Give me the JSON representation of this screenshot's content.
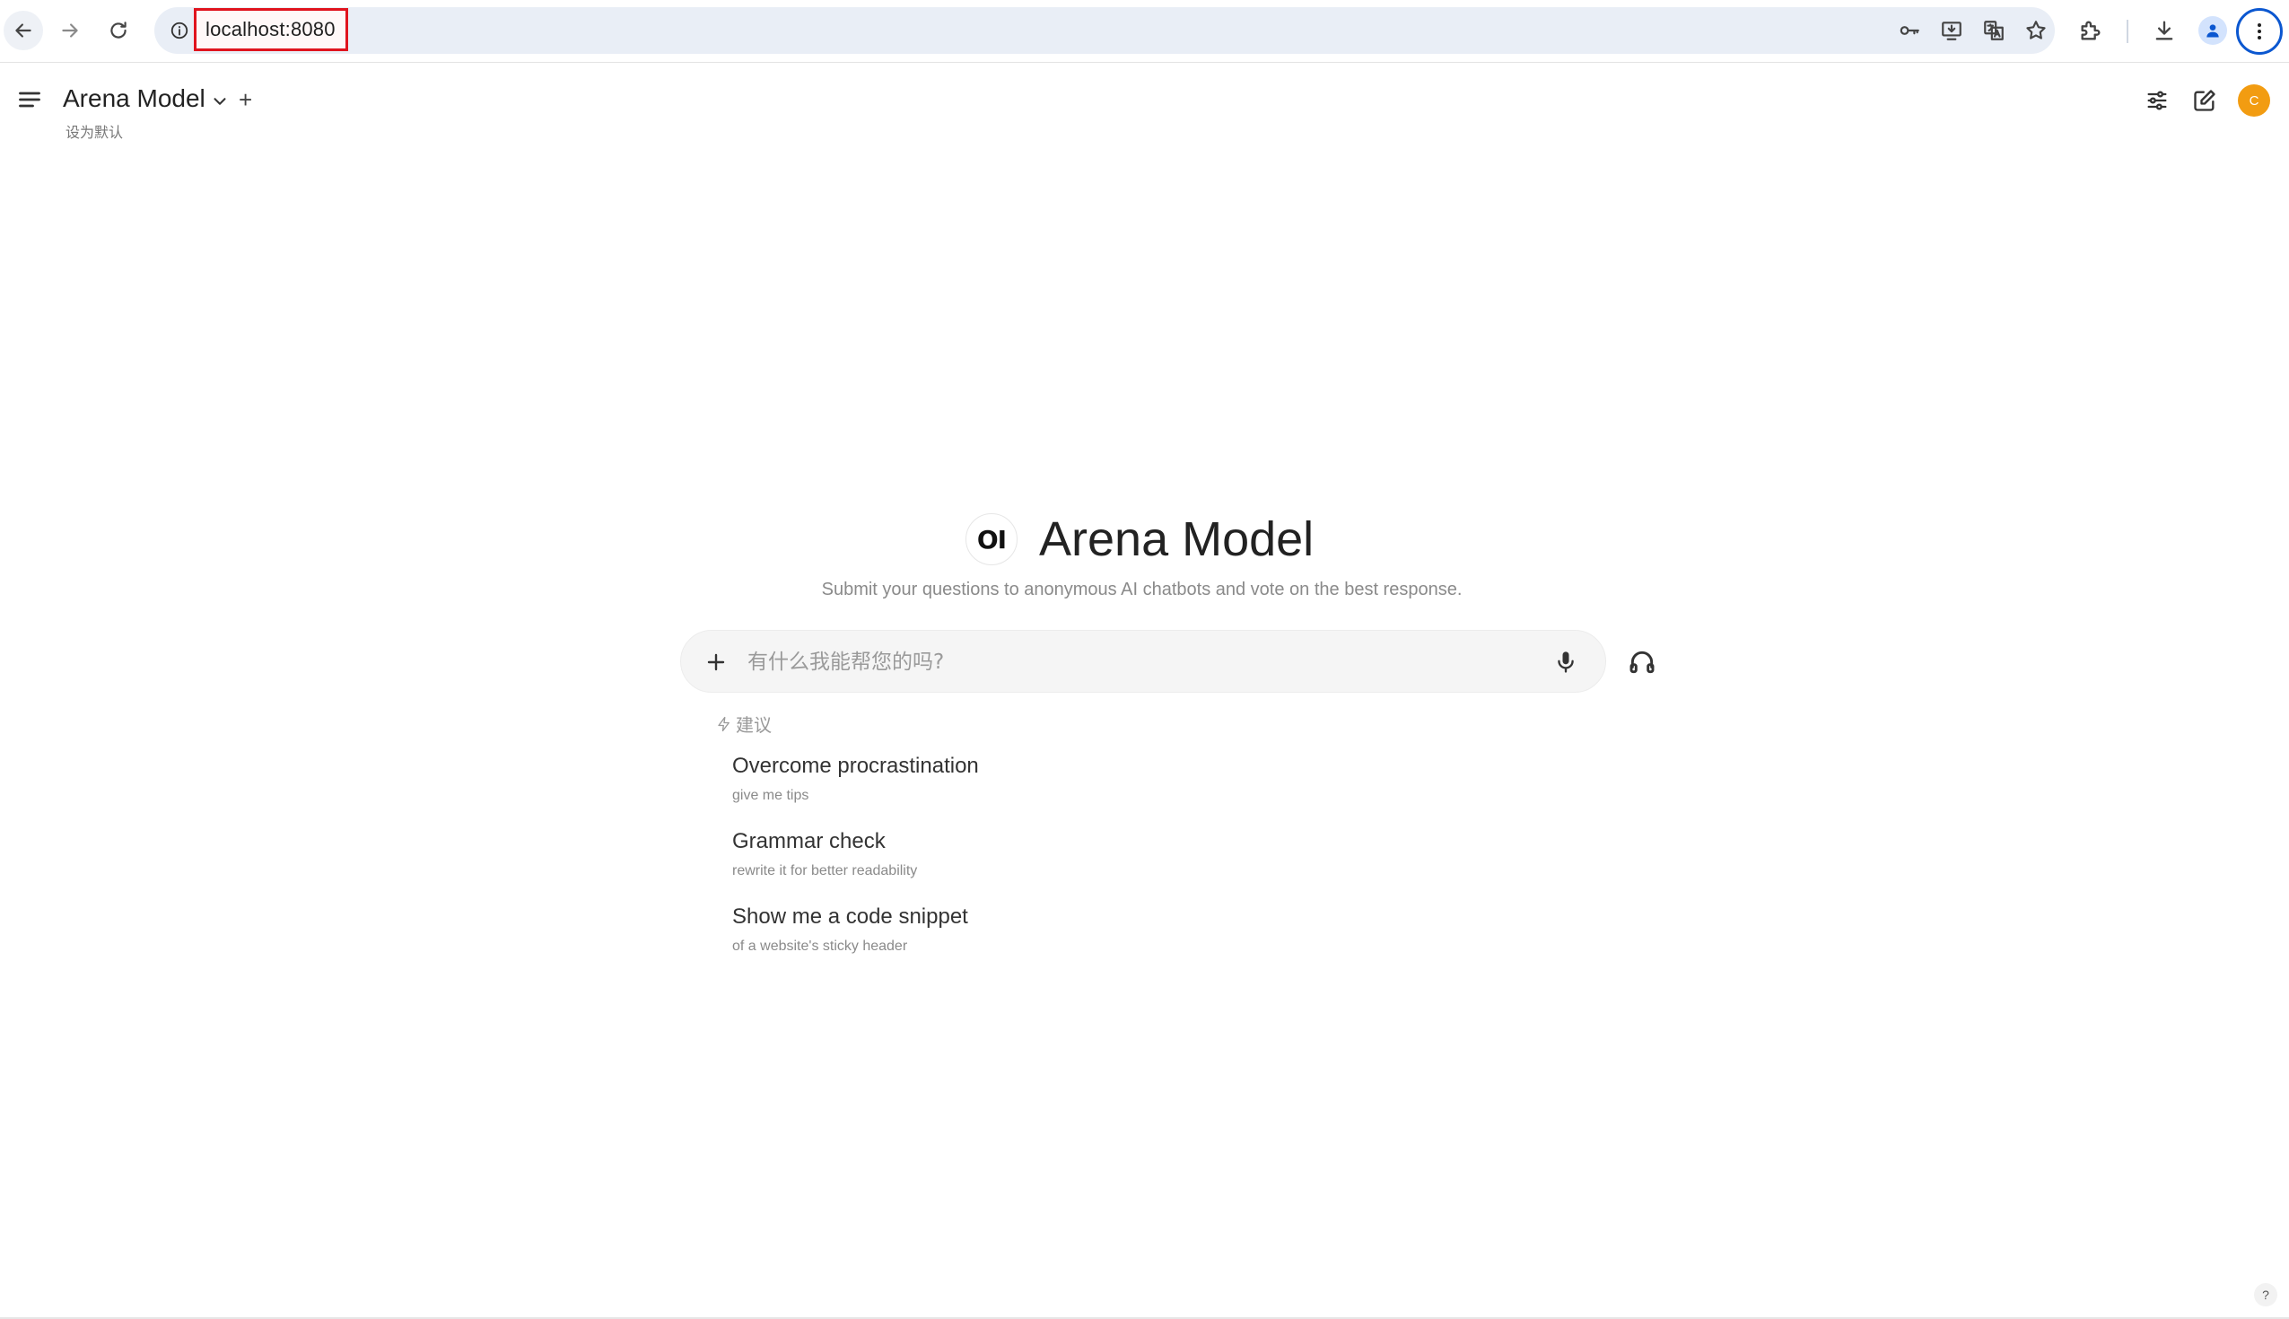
{
  "browser": {
    "url": "localhost:8080"
  },
  "header": {
    "model_name": "Arena Model",
    "add_label": "+",
    "set_default": "设为默认",
    "user_initial": "C"
  },
  "hero": {
    "logo_text": "OI",
    "title": "Arena Model",
    "subtitle": "Submit your questions to anonymous AI chatbots and vote on the best response."
  },
  "input": {
    "placeholder": "有什么我能帮您的吗?",
    "value": ""
  },
  "suggestions": {
    "header": "建议",
    "items": [
      {
        "title": "Overcome procrastination",
        "subtitle": "give me tips"
      },
      {
        "title": "Grammar check",
        "subtitle": "rewrite it for better readability"
      },
      {
        "title": "Show me a code snippet",
        "subtitle": "of a website's sticky header"
      }
    ]
  },
  "help": {
    "label": "?"
  },
  "colors": {
    "avatar": "#f29c11",
    "url_highlight": "#e0141e",
    "omnibox_bg": "#e9eef6",
    "accent": "#0b57d0"
  }
}
